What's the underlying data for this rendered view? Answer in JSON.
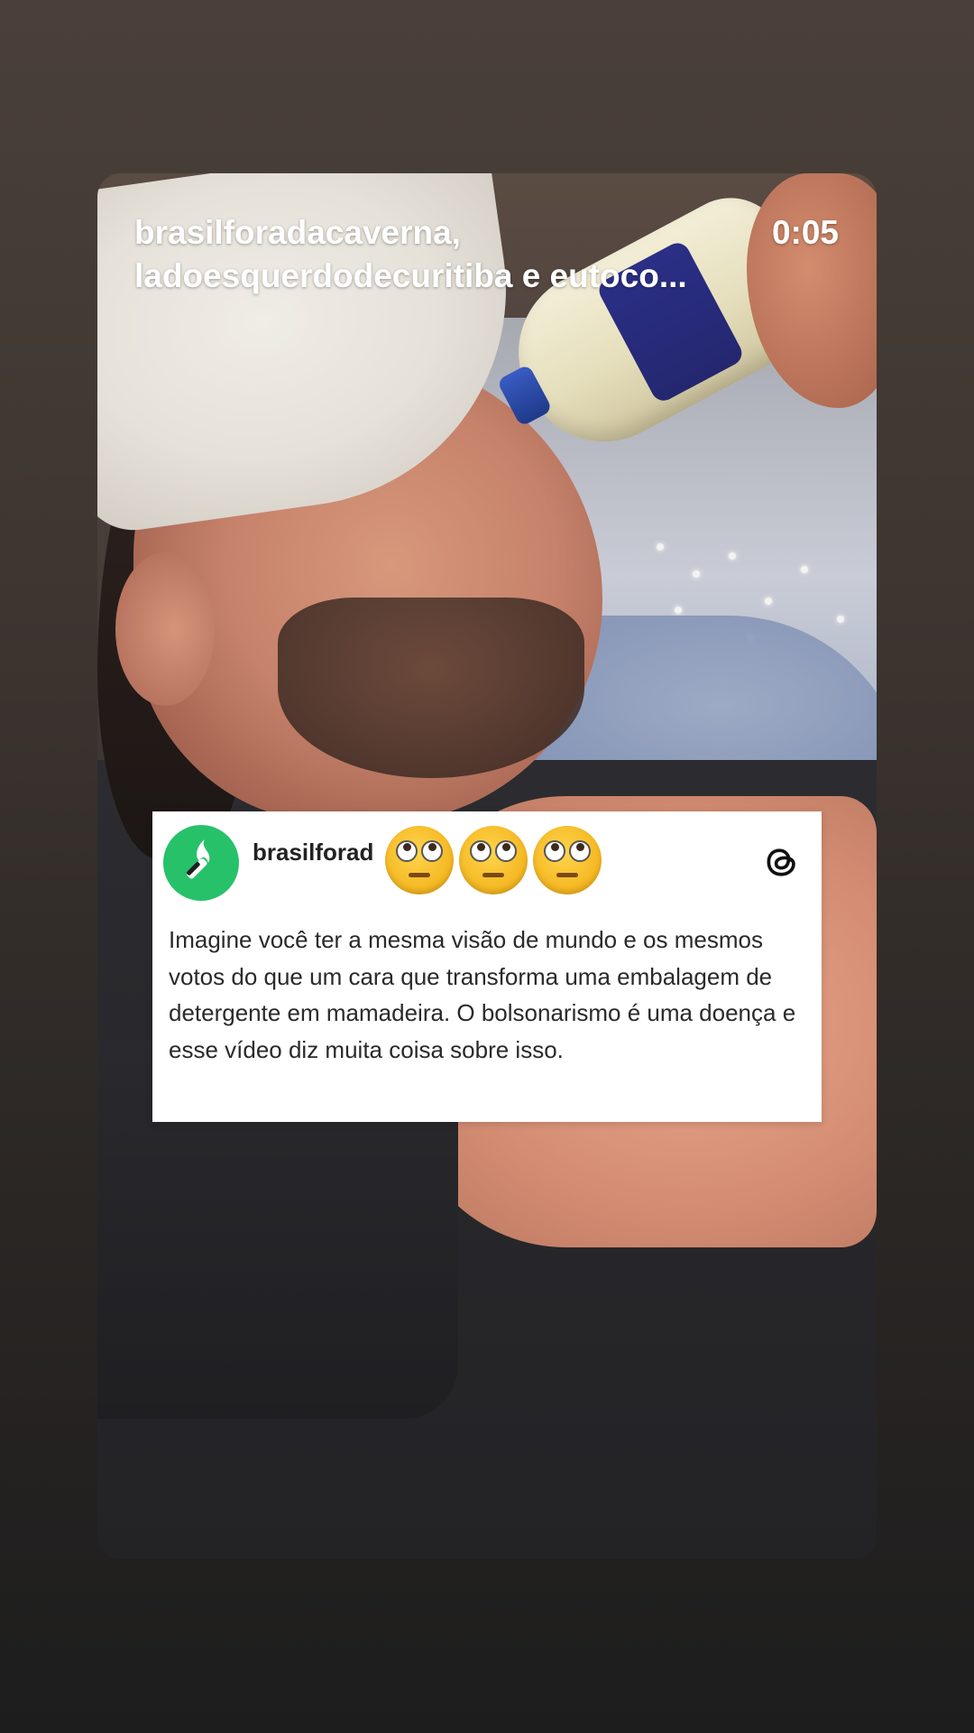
{
  "story": {
    "header_line1": "brasilforadacaverna,",
    "header_line2": "ladoesquerdodecuritiba e eutoco...",
    "timer": "0:05"
  },
  "post": {
    "username": "brasilforad",
    "emoji_count": 3,
    "emoji_name": "face-with-rolling-eyes",
    "platform_icon": "threads-icon",
    "text": "Imagine você ter a mesma visão de mundo e os mesmos votos do que um cara que transforma uma embalagem de detergente em mamadeira. O bolsonarismo é uma doença e esse vídeo diz muita coisa sobre isso.",
    "avatar_color": "#27c16a"
  }
}
